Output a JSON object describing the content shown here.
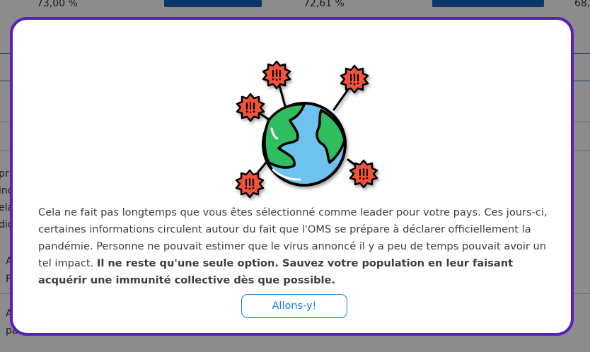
{
  "background": {
    "stats": [
      "73,00 %",
      "72,61 %",
      "68,"
    ],
    "fragments": [
      "pr",
      "inc",
      "ela",
      "dic",
      "A",
      "F",
      "A",
      "pa"
    ]
  },
  "modal": {
    "message_regular": "Cela ne fait pas longtemps que vous êtes sélectionné comme leader pour votre pays. Ces jours-ci, certaines informations circulent autour du fait que l'OMS se prépare à déclarer officiellement la pandémie. Personne ne pouvait estimer que le virus annoncé il y a peu de temps pouvait avoir un tel impact. ",
    "message_bold": "Il ne reste qu'une seule option. Sauvez votre population en leur faisant acquérir une immunité collective dès que possible.",
    "button_label": "Allons-y!"
  },
  "colors": {
    "accent": "#1e7fd4",
    "modal_border": "#5b1fb8",
    "globe_water": "#6ec3ee",
    "globe_land": "#2ebd5e",
    "virus": "#f4533b"
  }
}
